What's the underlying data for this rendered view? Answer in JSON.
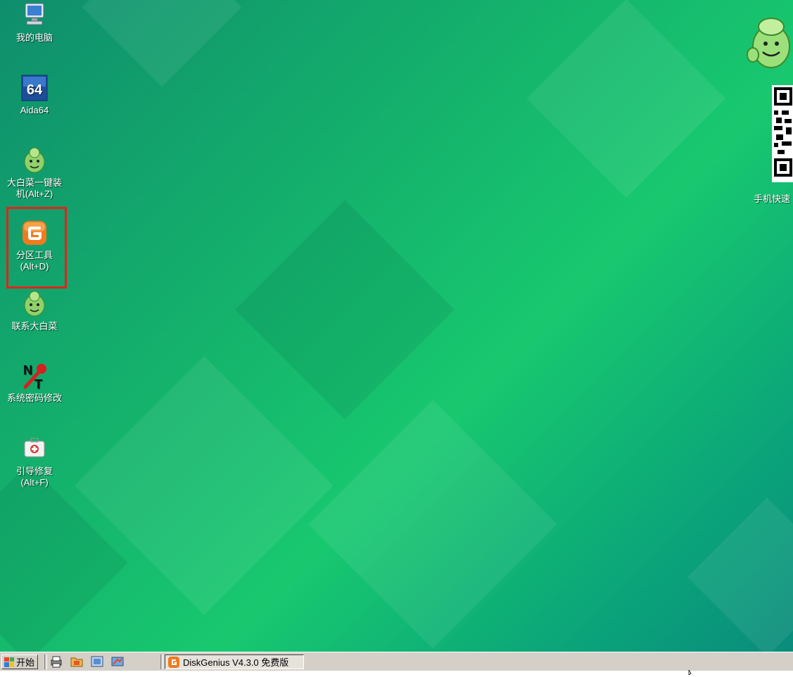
{
  "desktop": {
    "icons": [
      {
        "label_lines": [
          "我的电脑"
        ],
        "icon": "computer-icon"
      },
      {
        "label_lines": [
          "Aida64"
        ],
        "icon": "aida64-icon"
      },
      {
        "label_lines": [
          "大白菜一键装",
          "机(Alt+Z)"
        ],
        "icon": "dabaicai-install-icon"
      },
      {
        "label_lines": [
          "分区工具",
          "(Alt+D)"
        ],
        "icon": "diskgenius-icon"
      },
      {
        "label_lines": [
          "联系大白菜"
        ],
        "icon": "dabaicai-contact-icon"
      },
      {
        "label_lines": [
          "系统密码修改"
        ],
        "icon": "nt-password-icon"
      },
      {
        "label_lines": [
          "引导修复",
          "(Alt+F)"
        ],
        "icon": "boot-repair-icon"
      }
    ],
    "right": {
      "qr_label": "手机快速",
      "mascot_icon": "dabaicai-mascot-icon",
      "qr_icon": "qr-code-icon"
    },
    "highlight_color": "#e0241a"
  },
  "taskbar": {
    "start_label": "开始",
    "quick_launch": [
      "printer-icon",
      "folder-icon",
      "screen-icon",
      "tools-icon"
    ],
    "active_task": "DiskGenius V4.3.0 免费版",
    "active_task_icon": "diskgenius-icon"
  }
}
